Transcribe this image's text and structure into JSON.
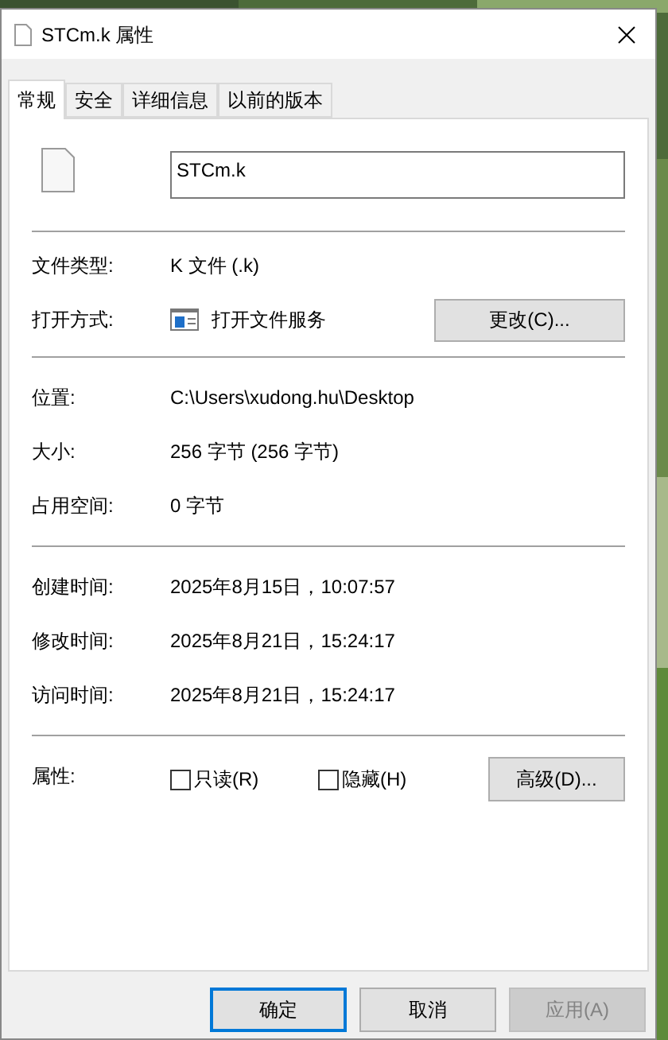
{
  "window": {
    "title": "STCm.k 属性"
  },
  "tabs": [
    {
      "label": "常规",
      "selected": true
    },
    {
      "label": "安全",
      "selected": false
    },
    {
      "label": "详细信息",
      "selected": false
    },
    {
      "label": "以前的版本",
      "selected": false
    }
  ],
  "file_name": {
    "value": "STCm.k"
  },
  "file_type": {
    "label": "文件类型:",
    "value": "K 文件 (.k)"
  },
  "open_with": {
    "label": "打开方式:",
    "value": "打开文件服务",
    "button": "更改(C)..."
  },
  "location_group": [
    {
      "label": "位置:",
      "value": "C:\\Users\\xudong.hu\\Desktop"
    },
    {
      "label": "大小:",
      "value": "256 字节 (256 字节)"
    },
    {
      "label": "占用空间:",
      "value": "0 字节"
    }
  ],
  "time_group": [
    {
      "label": "创建时间:",
      "value": "2025年8月15日，10:07:57"
    },
    {
      "label": "修改时间:",
      "value": "2025年8月21日，15:24:17"
    },
    {
      "label": "访问时间:",
      "value": "2025年8月21日，15:24:17"
    }
  ],
  "attributes": {
    "label": "属性:",
    "checkboxes": [
      {
        "label": "只读(R)",
        "checked": false
      },
      {
        "label": "隐藏(H)",
        "checked": false
      }
    ],
    "button": "高级(D)..."
  },
  "buttons": [
    {
      "label": "确定",
      "default": true,
      "disabled": false
    },
    {
      "label": "取消",
      "default": false,
      "disabled": false
    },
    {
      "label": "应用(A)",
      "default": false,
      "disabled": true
    }
  ]
}
